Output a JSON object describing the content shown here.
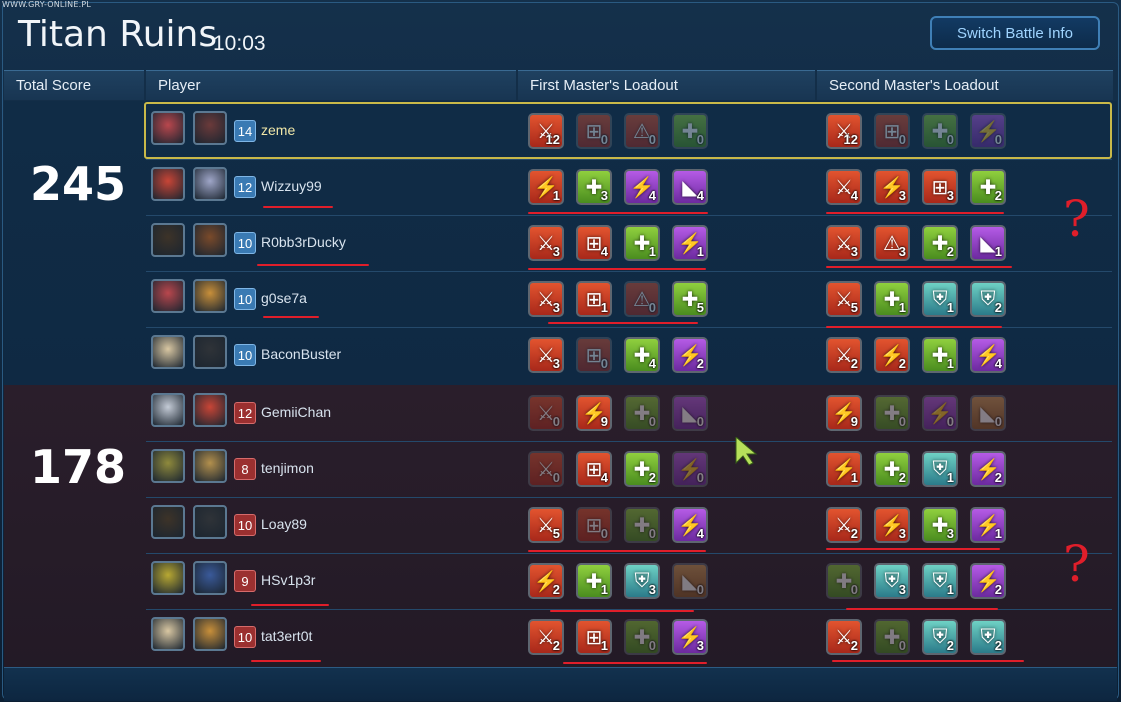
{
  "watermark": "WWW.GRY-ONLINE.PL",
  "header": {
    "title": "Titan Ruins",
    "timer": "10:03",
    "switch_label": "Switch Battle Info"
  },
  "columns": {
    "score": "Total Score",
    "player": "Player",
    "first": "First Master's Loadout",
    "second": "Second Master's Loadout"
  },
  "teams": [
    {
      "score": "245",
      "players": [
        {
          "name": "zeme",
          "level": "14"
        },
        {
          "name": "Wizzuy99",
          "level": "12"
        },
        {
          "name": "R0bb3rDucky",
          "level": "10"
        },
        {
          "name": "g0se7a",
          "level": "10"
        },
        {
          "name": "BaconBuster",
          "level": "10"
        }
      ]
    },
    {
      "score": "178",
      "players": [
        {
          "name": "GemiiChan",
          "level": "12"
        },
        {
          "name": "tenjimon",
          "level": "8"
        },
        {
          "name": "Loay89",
          "level": "10"
        },
        {
          "name": "HSv1p3r",
          "level": "9"
        },
        {
          "name": "tat3ert0t",
          "level": "10"
        }
      ]
    }
  ],
  "loadouts": [
    {
      "first": [
        [
          "swords-icon",
          "12"
        ],
        [
          "target-icon",
          "0"
        ],
        [
          "warning-icon",
          "0"
        ],
        [
          "medkit-icon",
          "0"
        ]
      ],
      "second": [
        [
          "swords-icon",
          "12"
        ],
        [
          "target-icon",
          "0"
        ],
        [
          "medkit-icon",
          "0"
        ],
        [
          "lightning-icon",
          "0"
        ]
      ]
    },
    {
      "first": [
        [
          "lightning-icon",
          "1"
        ],
        [
          "medkit-icon",
          "3"
        ],
        [
          "lightning-icon",
          "4"
        ],
        [
          "boot-icon",
          "4"
        ]
      ],
      "second": [
        [
          "swords-icon",
          "4"
        ],
        [
          "lightning-icon",
          "3"
        ],
        [
          "target-icon",
          "3"
        ],
        [
          "medkit-icon",
          "2"
        ]
      ]
    },
    {
      "first": [
        [
          "swords-icon",
          "3"
        ],
        [
          "target-icon",
          "4"
        ],
        [
          "medkit-icon",
          "1"
        ],
        [
          "lightning-icon",
          "1"
        ]
      ],
      "second": [
        [
          "swords-icon",
          "3"
        ],
        [
          "warning-icon",
          "3"
        ],
        [
          "medkit-icon",
          "2"
        ],
        [
          "boot-icon",
          "1"
        ]
      ]
    },
    {
      "first": [
        [
          "swords-icon",
          "3"
        ],
        [
          "target-icon",
          "1"
        ],
        [
          "warning-icon",
          "0"
        ],
        [
          "medkit-icon",
          "5"
        ]
      ],
      "second": [
        [
          "swords-icon",
          "5"
        ],
        [
          "medkit-icon",
          "1"
        ],
        [
          "shield-icon",
          "1"
        ],
        [
          "shield-icon",
          "2"
        ]
      ]
    },
    {
      "first": [
        [
          "swords-icon",
          "3"
        ],
        [
          "target-icon",
          "0"
        ],
        [
          "medkit-icon",
          "4"
        ],
        [
          "lightning-icon",
          "2"
        ]
      ],
      "second": [
        [
          "swords-icon",
          "2"
        ],
        [
          "lightning-icon",
          "2"
        ],
        [
          "medkit-icon",
          "1"
        ],
        [
          "lightning-icon",
          "4"
        ]
      ]
    },
    {
      "first": [
        [
          "swords-icon",
          "0"
        ],
        [
          "lightning-icon",
          "9"
        ],
        [
          "medkit-icon",
          "0"
        ],
        [
          "boot-icon",
          "0"
        ]
      ],
      "second": [
        [
          "lightning-icon",
          "9"
        ],
        [
          "medkit-icon",
          "0"
        ],
        [
          "lightning-icon",
          "0"
        ],
        [
          "boot-icon",
          "0"
        ]
      ]
    },
    {
      "first": [
        [
          "swords-icon",
          "0"
        ],
        [
          "target-icon",
          "4"
        ],
        [
          "medkit-icon",
          "2"
        ],
        [
          "lightning-icon",
          "0"
        ]
      ],
      "second": [
        [
          "lightning-icon",
          "1"
        ],
        [
          "medkit-icon",
          "2"
        ],
        [
          "shield-icon",
          "1"
        ],
        [
          "lightning-icon",
          "2"
        ]
      ]
    },
    {
      "first": [
        [
          "swords-icon",
          "5"
        ],
        [
          "target-icon",
          "0"
        ],
        [
          "medkit-icon",
          "0"
        ],
        [
          "lightning-icon",
          "4"
        ]
      ],
      "second": [
        [
          "swords-icon",
          "2"
        ],
        [
          "lightning-icon",
          "3"
        ],
        [
          "medkit-icon",
          "3"
        ],
        [
          "lightning-icon",
          "1"
        ]
      ]
    },
    {
      "first": [
        [
          "lightning-icon",
          "2"
        ],
        [
          "medkit-icon",
          "1"
        ],
        [
          "shield-icon",
          "3"
        ],
        [
          "boot-icon",
          "0"
        ]
      ],
      "second": [
        [
          "medkit-icon",
          "0"
        ],
        [
          "shield-icon",
          "3"
        ],
        [
          "shield-icon",
          "1"
        ],
        [
          "lightning-icon",
          "2"
        ]
      ]
    },
    {
      "first": [
        [
          "swords-icon",
          "2"
        ],
        [
          "target-icon",
          "1"
        ],
        [
          "medkit-icon",
          "0"
        ],
        [
          "lightning-icon",
          "3"
        ]
      ],
      "second": [
        [
          "swords-icon",
          "2"
        ],
        [
          "medkit-icon",
          "0"
        ],
        [
          "shield-icon",
          "2"
        ],
        [
          "shield-icon",
          "2"
        ]
      ]
    }
  ],
  "colors": {
    "accent": "#3f7fb6",
    "highlight": "#c9b949",
    "annotation": "#e01e2a"
  }
}
